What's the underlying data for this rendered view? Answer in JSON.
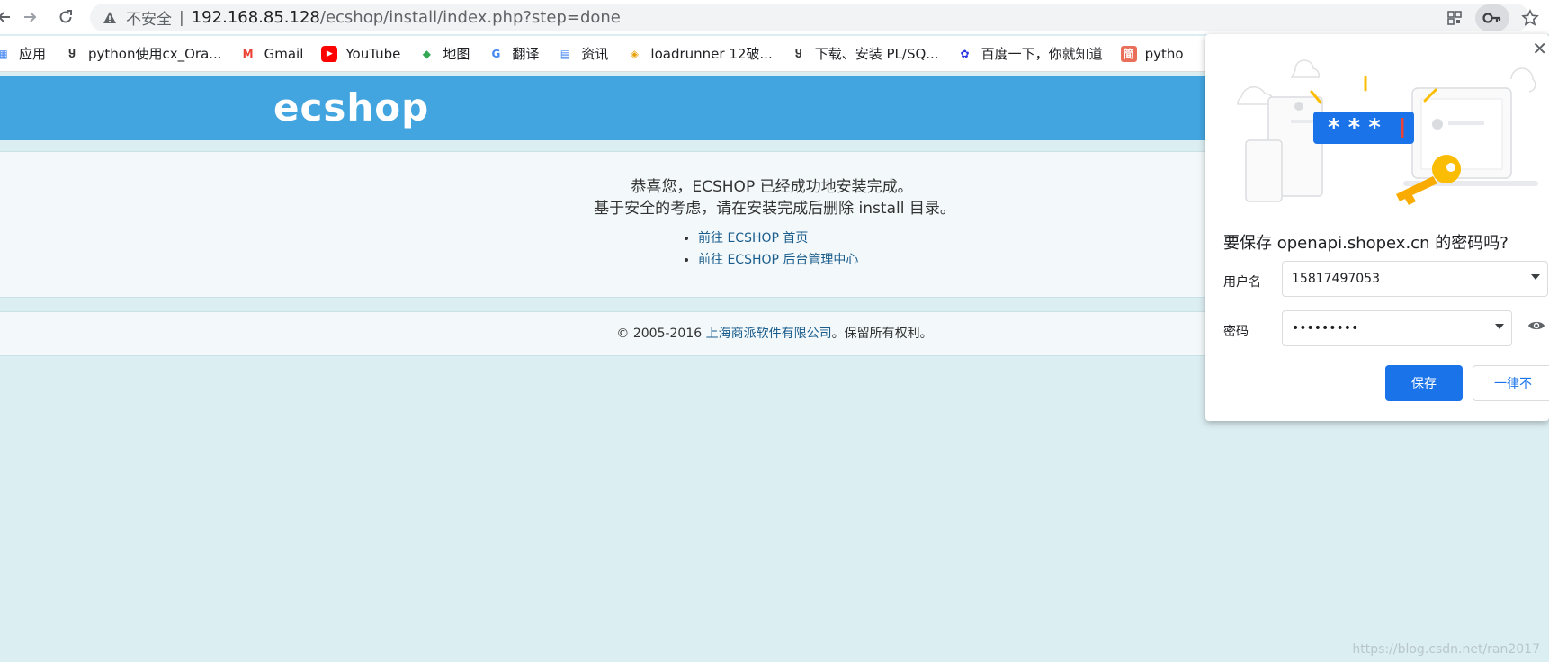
{
  "browser": {
    "insecure_label": "不安全",
    "separator": "|",
    "url_host": "192.168.85.128",
    "url_path": "/ecshop/install/index.php?step=done"
  },
  "bookmarks": [
    {
      "label": "应用",
      "icon": "apps-grid-icon",
      "color": "#4285f4"
    },
    {
      "label": "python使用cx_Ora...",
      "icon": "csdn-icon",
      "color": "#333333"
    },
    {
      "label": "Gmail",
      "icon": "gmail-icon",
      "color": "#ea4335"
    },
    {
      "label": "YouTube",
      "icon": "youtube-icon",
      "color": "#ff0000"
    },
    {
      "label": "地图",
      "icon": "maps-icon",
      "color": "#34a853"
    },
    {
      "label": "翻译",
      "icon": "translate-icon",
      "color": "#4285f4"
    },
    {
      "label": "资讯",
      "icon": "news-icon",
      "color": "#4285f4"
    },
    {
      "label": "loadrunner 12破...",
      "icon": "loadrunner-icon",
      "color": "#e8a000"
    },
    {
      "label": "下载、安装 PL/SQ...",
      "icon": "csdn-icon",
      "color": "#333333"
    },
    {
      "label": "百度一下，你就知道",
      "icon": "baidu-icon",
      "color": "#2932e1"
    },
    {
      "label": "pytho",
      "icon": "jianshu-icon",
      "color": "#ea6f5a"
    }
  ],
  "page": {
    "logo": "ecshop",
    "message_line1": "恭喜您，ECSHOP 已经成功地安装完成。",
    "message_line2": "基于安全的考虑，请在安装完成后删除 install 目录。",
    "link_home": "前往 ECSHOP 首页",
    "link_admin": "前往 ECSHOP 后台管理中心",
    "footer_prefix": "© 2005-2016 ",
    "footer_company": "上海商派软件有限公司",
    "footer_suffix": "。保留所有权利。",
    "watermark": "https://blog.csdn.net/ran2017"
  },
  "password_popup": {
    "title": "要保存 openapi.shopex.cn 的密码吗?",
    "username_label": "用户名",
    "username_value": "15817497053",
    "password_label": "密码",
    "password_value": "•••••••••",
    "save_label": "保存",
    "never_label": "一律不",
    "illustration_text": "* * *"
  },
  "colors": {
    "header_blue": "#42a5e0",
    "page_bg": "#dbeef2",
    "button_blue": "#1a73e8"
  }
}
